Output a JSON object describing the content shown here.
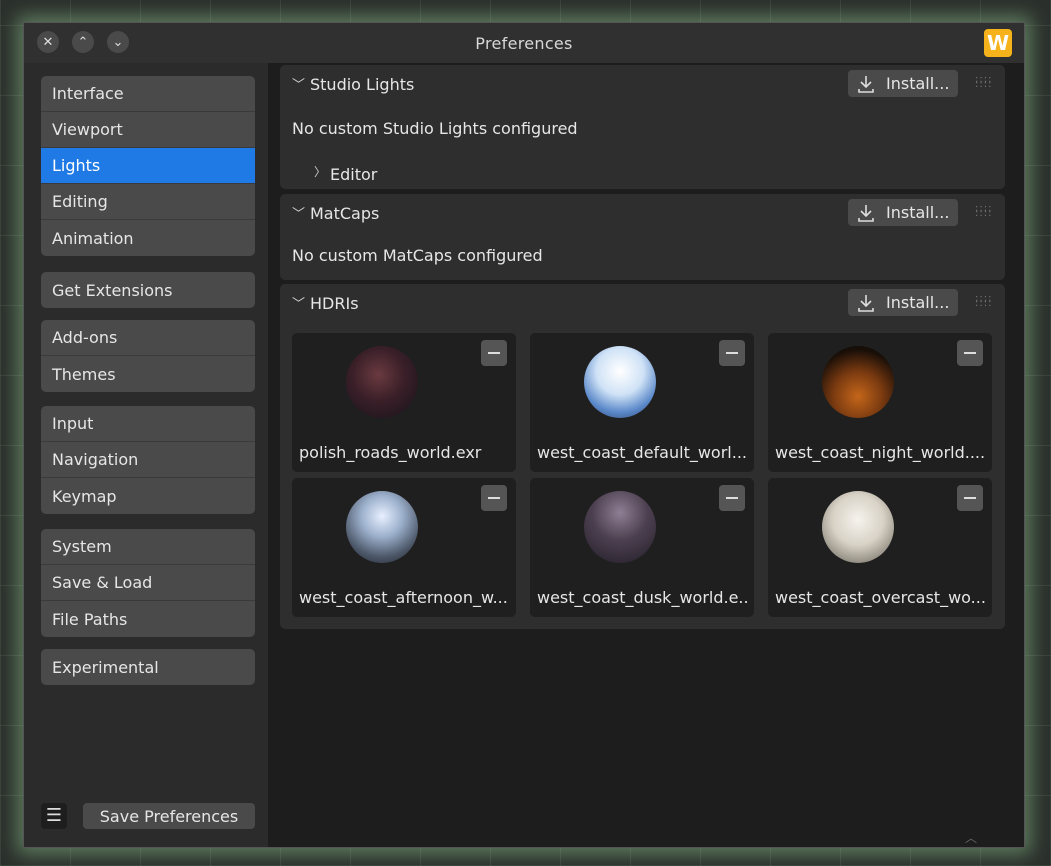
{
  "window": {
    "title": "Preferences",
    "logo_letter": "W"
  },
  "titlebar": {
    "close_glyph": "✕",
    "up_glyph": "⌃",
    "down_glyph": "⌄"
  },
  "sidebar": {
    "groups": [
      [
        "Interface",
        "Viewport",
        "Lights",
        "Editing",
        "Animation"
      ],
      [
        "Get Extensions"
      ],
      [
        "Add-ons",
        "Themes"
      ],
      [
        "Input",
        "Navigation",
        "Keymap"
      ],
      [
        "System",
        "Save & Load",
        "File Paths"
      ],
      [
        "Experimental"
      ]
    ],
    "active": "Lights",
    "menu_glyph": "☰",
    "save_label": "Save Preferences"
  },
  "panels": {
    "studio": {
      "title": "Studio Lights",
      "install": "Install...",
      "message": "No custom Studio Lights configured",
      "sub_label": "Editor"
    },
    "matcaps": {
      "title": "MatCaps",
      "install": "Install...",
      "message": "No custom MatCaps configured"
    },
    "hdris": {
      "title": "HDRIs",
      "install": "Install...",
      "items": [
        {
          "label": "polish_roads_world.exr",
          "sphere": "polish-roads"
        },
        {
          "label": "west_coast_default_worl...",
          "sphere": "default"
        },
        {
          "label": "west_coast_night_world....",
          "sphere": "night"
        },
        {
          "label": "west_coast_afternoon_w...",
          "sphere": "afternoon"
        },
        {
          "label": "west_coast_dusk_world.e...",
          "sphere": "dusk"
        },
        {
          "label": "west_coast_overcast_wo...",
          "sphere": "overcast"
        }
      ]
    }
  },
  "colors": {
    "accent": "#1f7ae6",
    "logo": "#f5b21a"
  }
}
